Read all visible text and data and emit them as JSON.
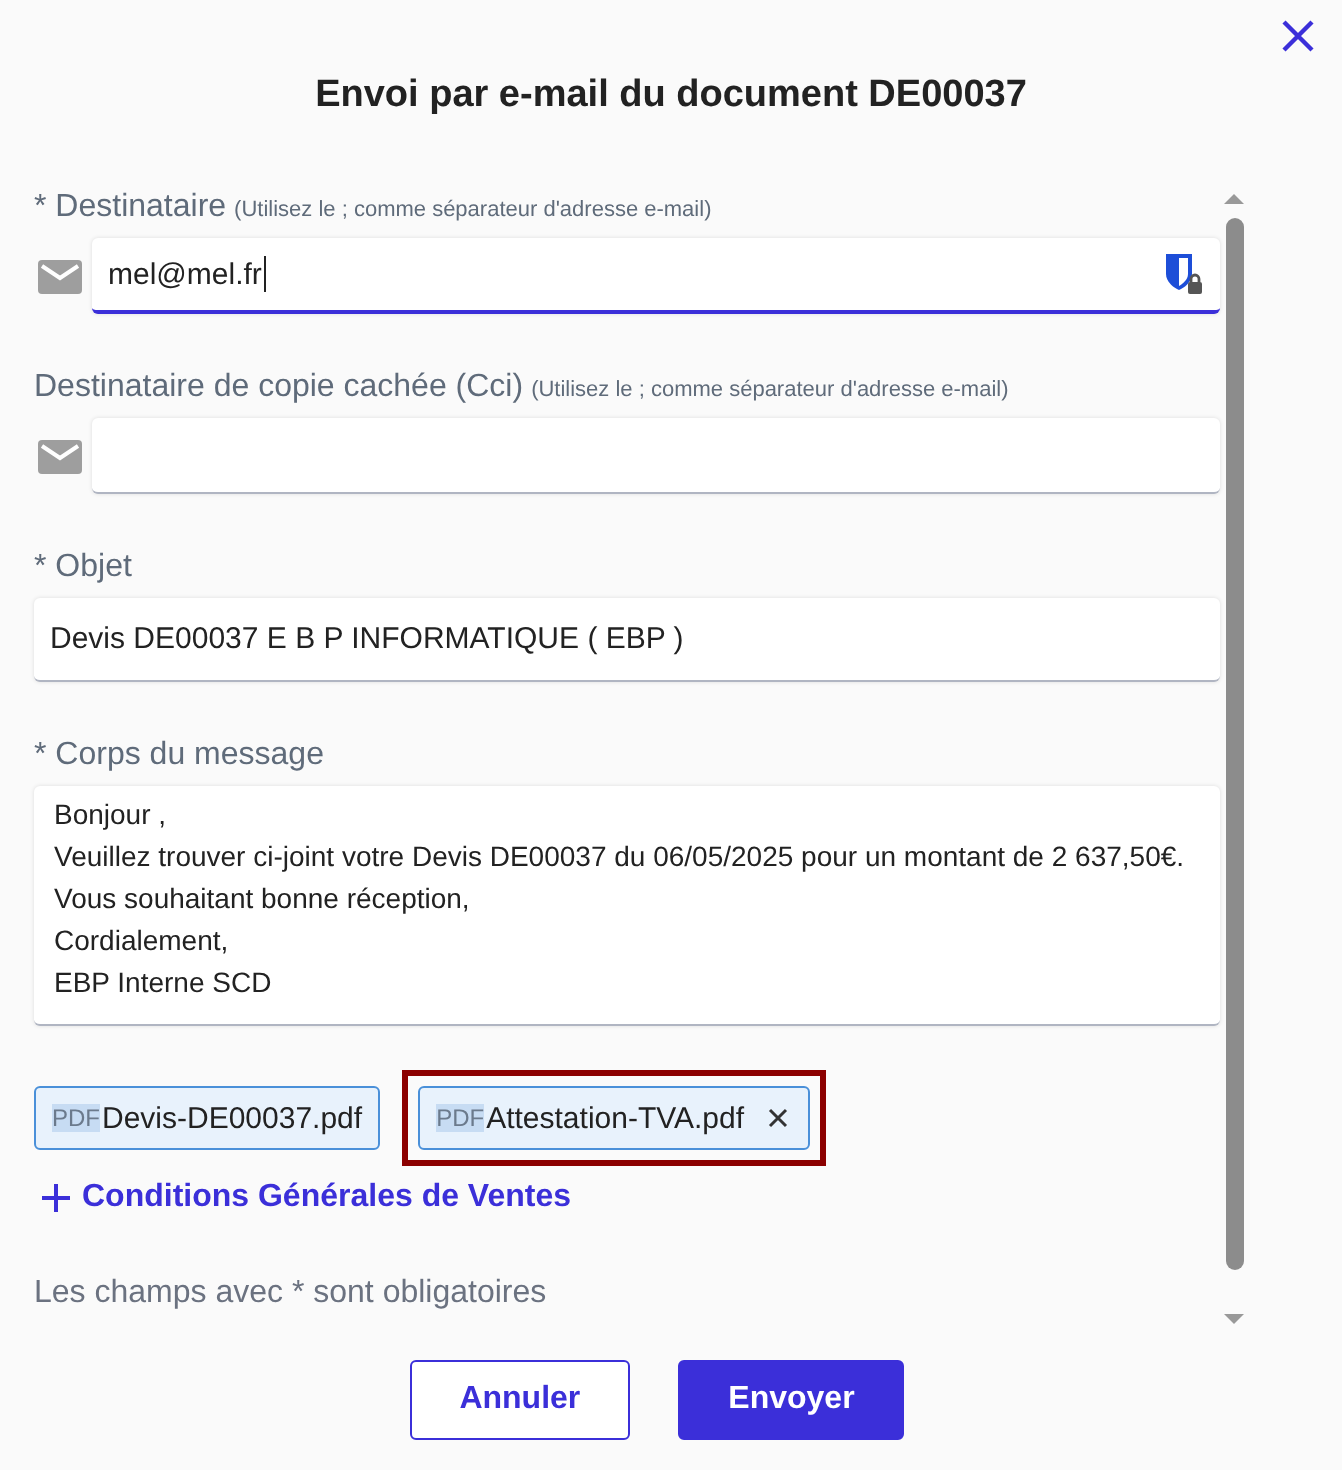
{
  "dialog": {
    "title": "Envoi par e-mail du document DE00037"
  },
  "fields": [
    {
      "kind": "email",
      "label": "* Destinataire",
      "hint": "(Utilisez le ; comme séparateur d'adresse e-mail)",
      "value": "mel@mel.fr",
      "focused": true,
      "password_manager": true
    },
    {
      "kind": "email",
      "label": "Destinataire de copie cachée (Cci)",
      "hint": "(Utilisez le ; comme séparateur d'adresse e-mail)",
      "focused": false
    },
    {
      "kind": "text",
      "label": "* Objet",
      "value": "Devis DE00037 E B P INFORMATIQUE ( EBP )",
      "focused": false
    },
    {
      "kind": "textarea",
      "label": "* Corps du message",
      "lines": [
        "Bonjour ,",
        "Veuillez trouver ci-joint votre Devis DE00037 du 06/05/2025 pour un montant de 2 637,50€.",
        "Vous souhaitant bonne réception,",
        "Cordialement,",
        "EBP Interne SCD"
      ],
      "focused": false
    }
  ],
  "attachments": [
    {
      "type_tag": "PDF",
      "label": "Devis-DE00037.pdf",
      "removable": false,
      "highlighted": false
    },
    {
      "type_tag": "PDF",
      "label": "Attestation-TVA.pdf",
      "removable": true,
      "highlighted": true
    }
  ],
  "add_link": {
    "label": "Conditions Générales de Ventes"
  },
  "note": "Les champs avec * sont obligatoires",
  "buttons": [
    {
      "label": "Annuler",
      "kind": "secondary"
    },
    {
      "label": "Envoyer",
      "kind": "primary"
    }
  ]
}
